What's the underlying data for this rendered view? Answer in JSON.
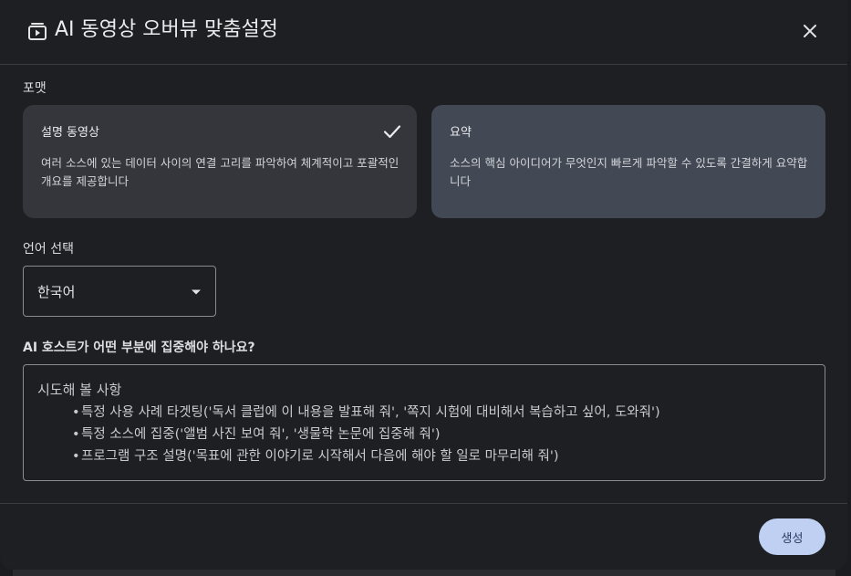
{
  "header": {
    "title": "AI 동영상 오버뷰 맞춤설정",
    "icon": "video-collection-icon",
    "close_icon": "close-icon"
  },
  "format": {
    "label": "포맷",
    "options": [
      {
        "title": "설명 동영상",
        "description": "여러 소스에 있는 데이터 사이의 연결 고리를 파악하여 체계적이고 포괄적인 개요를 제공합니다",
        "selected": true
      },
      {
        "title": "요약",
        "description": "소스의 핵심 아이디어가 무엇인지 빠르게 파악할 수 있도록 간결하게 요약합니다",
        "selected": false
      }
    ]
  },
  "language": {
    "label": "언어 선택",
    "value": "한국어"
  },
  "focus": {
    "label": "AI 호스트가 어떤 부분에 집중해야 하나요?",
    "placeholder_title": "시도해 볼 사항",
    "placeholder_items": [
      "특정 사용 사례 타겟팅('독서 클럽에 이 내용을 발표해 줘', '쪽지 시험에 대비해서 복습하고 싶어, 도와줘')",
      "특정 소스에 집중('앨범 사진 보여 줘', '생물학 논문에 집중해 줘')",
      "프로그램 구조 설명('목표에 관한 이야기로 시작해서 다음에 해야 할 일로 마무리해 줘')"
    ]
  },
  "footer": {
    "generate_label": "생성"
  },
  "colors": {
    "dialog_bg": "#1e1f22",
    "selected_card_bg": "#35363b",
    "unselected_card_bg": "#424854",
    "primary_button_bg": "#c0d0f3"
  }
}
